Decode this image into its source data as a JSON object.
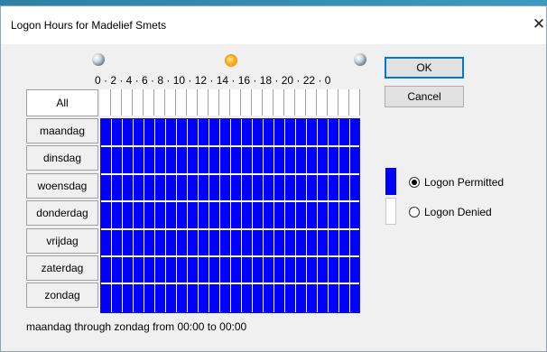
{
  "window": {
    "title": "Logon Hours for Madelief Smets",
    "close_glyph": "✕"
  },
  "ruler": {
    "labels": "0 · 2 · 4 · 6 · 8 · 10 · 12 · 14 · 16 · 18 · 20 · 22 · 0",
    "icons": [
      "moon-icon",
      "sun-icon",
      "moon-icon"
    ]
  },
  "buttons": {
    "ok": "OK",
    "cancel": "Cancel",
    "all": "All"
  },
  "days": [
    "maandag",
    "dinsdag",
    "woensdag",
    "donderdag",
    "vrijdag",
    "zaterdag",
    "zondag"
  ],
  "grid": {
    "hours": 24,
    "fill_color": "#0000ff",
    "all_permitted": true
  },
  "legend": {
    "permitted": "Logon Permitted",
    "denied": "Logon Denied",
    "selected": "permitted",
    "permitted_color": "#0000ff",
    "denied_color": "#ffffff"
  },
  "status": "maandag through zondag from 00:00 to 00:00"
}
